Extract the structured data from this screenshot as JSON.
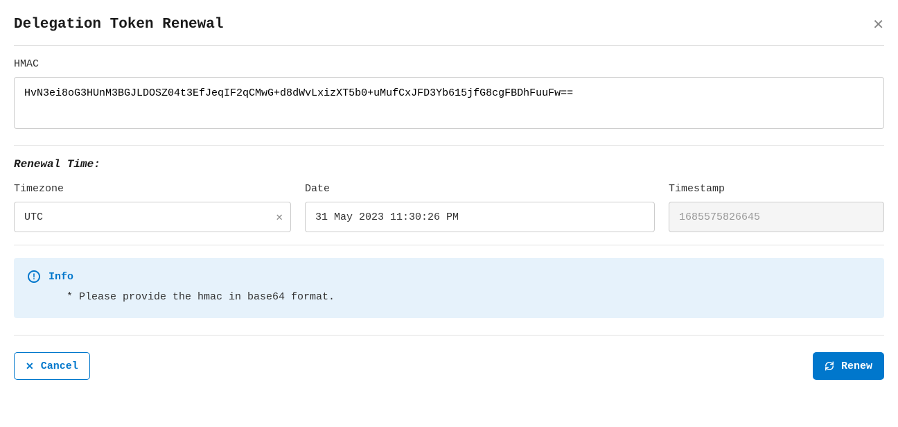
{
  "header": {
    "title": "Delegation Token Renewal"
  },
  "hmac": {
    "label": "HMAC",
    "value": "HvN3ei8oG3HUnM3BGJLDOSZ04t3EfJeqIF2qCMwG+d8dWvLxizXT5b0+uMufCxJFD3Yb615jfG8cgFBDhFuuFw=="
  },
  "renewal": {
    "title": "Renewal Time:",
    "timezone": {
      "label": "Timezone",
      "value": "UTC"
    },
    "date": {
      "label": "Date",
      "value": "31 May 2023 11:30:26 PM"
    },
    "timestamp": {
      "label": "Timestamp",
      "value": "1685575826645"
    }
  },
  "info": {
    "title": "Info",
    "text": "* Please provide the hmac in base64 format."
  },
  "actions": {
    "cancel": "Cancel",
    "renew": "Renew"
  }
}
